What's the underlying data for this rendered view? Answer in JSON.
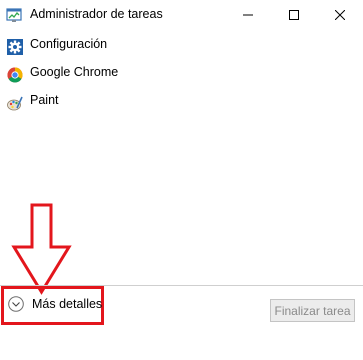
{
  "window": {
    "title": "Administrador de tareas",
    "title_icon": "task-manager-icon",
    "controls": {
      "minimize_icon": "minimize-icon",
      "maximize_icon": "maximize-icon",
      "close_icon": "close-icon"
    }
  },
  "apps": [
    {
      "label": "Configuración",
      "icon": "settings-gear-icon"
    },
    {
      "label": "Google Chrome",
      "icon": "chrome-icon"
    },
    {
      "label": "Paint",
      "icon": "paint-icon"
    }
  ],
  "footer": {
    "details_label": "Más detalles",
    "details_icon": "chevron-down-circle-icon",
    "end_task_label": "Finalizar tarea",
    "end_task_enabled": false
  },
  "annotation": {
    "arrow_color": "#e3161c",
    "highlight_color": "#e3161c"
  },
  "colors": {
    "accent_blue": "#1f6fbf",
    "divider": "#cfcfcf",
    "disabled_text": "#8a8a8a"
  }
}
